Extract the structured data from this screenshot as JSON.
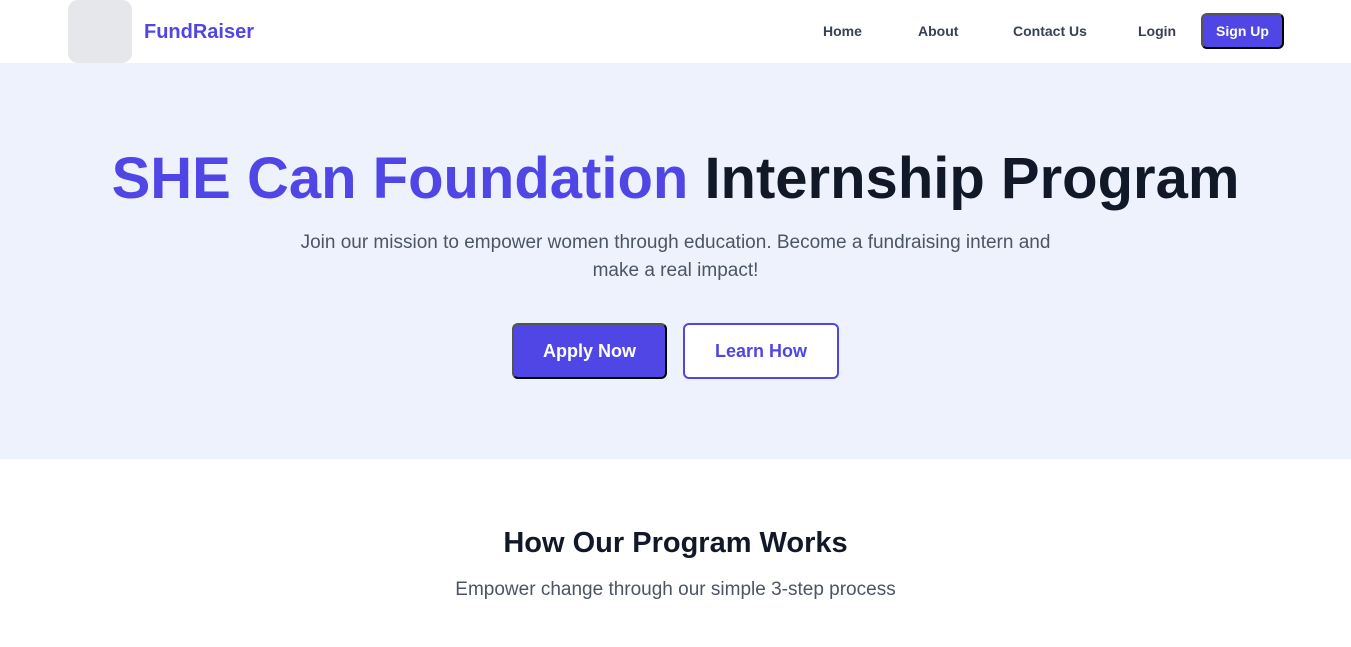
{
  "navbar": {
    "brand": "FundRaiser",
    "links": {
      "home": "Home",
      "about": "About",
      "contact": "Contact Us",
      "login": "Login"
    },
    "signup_label": "Sign Up"
  },
  "hero": {
    "title_accent": "SHE Can Foundation",
    "title_rest": " Internship Program",
    "subtitle": "Join our mission to empower women through education. Become a fundraising intern and make a real impact!",
    "apply_label": "Apply Now",
    "learn_label": "Learn How"
  },
  "how_it_works": {
    "title": "How Our Program Works",
    "subtitle": "Empower change through our simple 3-step process"
  },
  "colors": {
    "accent": "#4f46e5",
    "hero_background": "#eef2fd",
    "heading": "#111827",
    "body_text": "#4b5563"
  }
}
